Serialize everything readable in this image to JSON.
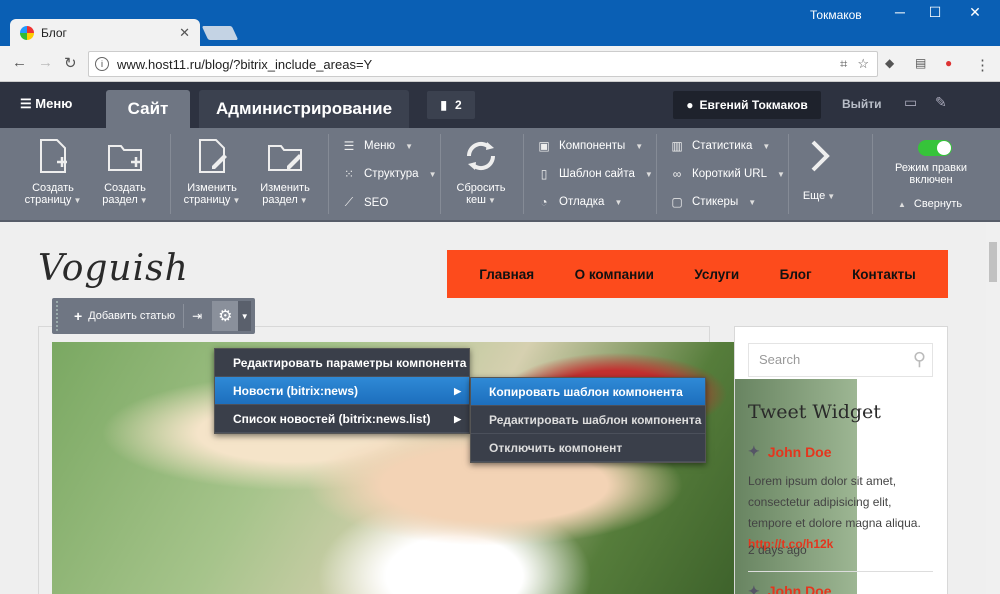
{
  "browser": {
    "tab_title": "Блог",
    "tab_close": "✕",
    "user_name": "Токмаков",
    "url": "www.host11.ru/blog/?bitrix_include_areas=Y"
  },
  "admin_panel": {
    "menu_label": "Меню",
    "tab_site": "Сайт",
    "tab_admin": "Администрирование",
    "notifications_count": "2",
    "user_button": "Евгений Токмаков",
    "logout": "Выйти"
  },
  "toolbar": {
    "create_page": [
      "Создать",
      "страницу"
    ],
    "create_section": [
      "Создать",
      "раздел"
    ],
    "edit_page": [
      "Изменить",
      "страницу"
    ],
    "edit_section": [
      "Изменить",
      "раздел"
    ],
    "menu": "Меню",
    "structure": "Структура",
    "seo": "SEO",
    "reset_cache": [
      "Сбросить",
      "кеш"
    ],
    "components": "Компоненты",
    "site_template": "Шаблон сайта",
    "debug": "Отладка",
    "statistics": "Статистика",
    "short_url": "Короткий URL",
    "stickers": "Стикеры",
    "more": "Еще",
    "edit_mode": [
      "Режим правки",
      "включен"
    ],
    "collapse": "Свернуть"
  },
  "site": {
    "logo": "Voguish",
    "nav": [
      "Главная",
      "О компании",
      "Услуги",
      "Блог",
      "Контакты"
    ]
  },
  "component_toolbar": {
    "add_article": "Добавить статью"
  },
  "context_menu": {
    "items": [
      "Редактировать параметры компонента",
      "Новости (bitrix:news)",
      "Список новостей (bitrix:news.list)"
    ],
    "submenu": [
      "Копировать шаблон компонента",
      "Редактировать шаблон компонента",
      "Отключить компонент"
    ]
  },
  "sidebar": {
    "search_placeholder": "Search",
    "widget_title": "Tweet Widget",
    "tweet_user": "John Doe",
    "tweet_text": "Lorem ipsum dolor sit amet, consectetur adipisicing elit, tempore et dolore magna aliqua.",
    "tweet_link": "http://t.co/h12k",
    "tweet_date": "2 days ago",
    "tweet_user2": "John Doe"
  }
}
